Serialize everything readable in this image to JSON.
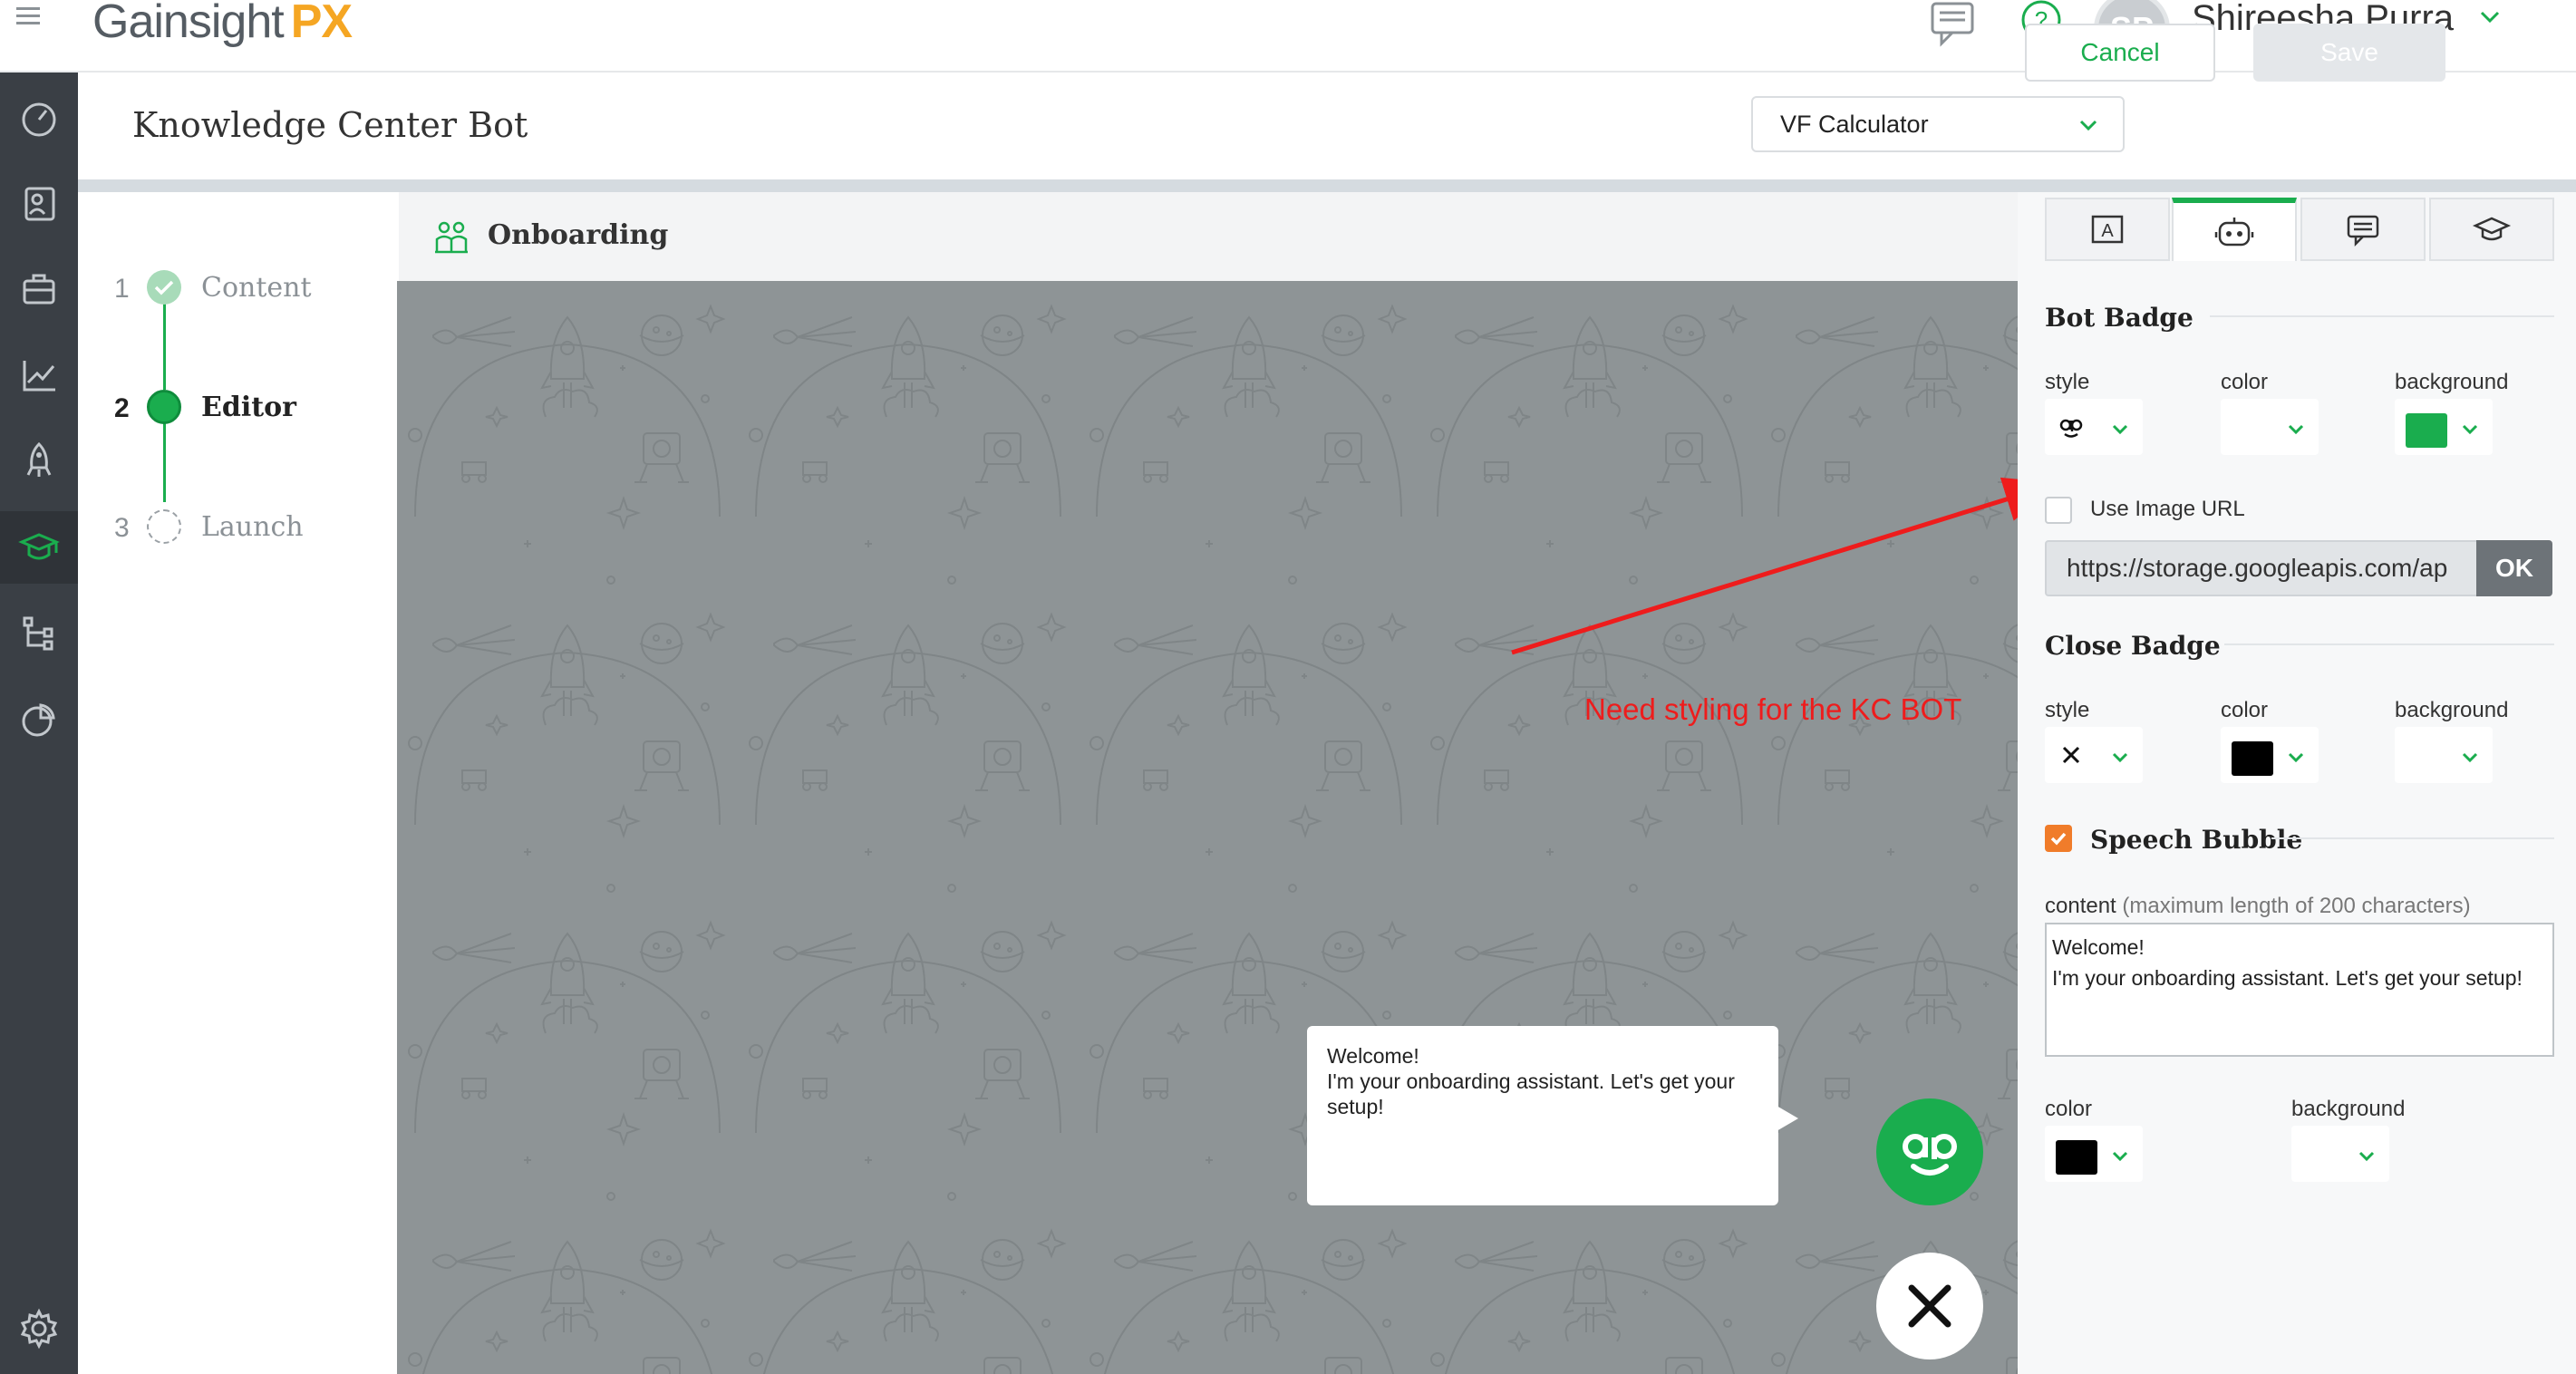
{
  "app": {
    "logo_main": "Gainsight",
    "logo_accent": "PX"
  },
  "user": {
    "initials": "SP",
    "name": "Shireesha Purra"
  },
  "header": {
    "title": "Knowledge Center Bot",
    "selected_guide": "VF Calculator",
    "cancel_label": "Cancel",
    "save_label": "Save"
  },
  "steps": [
    {
      "number": "1",
      "label": "Content",
      "state": "done"
    },
    {
      "number": "2",
      "label": "Editor",
      "state": "current"
    },
    {
      "number": "3",
      "label": "Launch",
      "state": "pending"
    }
  ],
  "canvas": {
    "section": "Onboarding",
    "annotation": "Need styling for the KC BOT",
    "bubble_lines": [
      "Welcome!",
      "I'm your onboarding assistant. Let's get your",
      "setup!"
    ]
  },
  "panel": {
    "bot_badge": {
      "title": "Bot Badge",
      "style_label": "style",
      "color_label": "color",
      "background_label": "background",
      "background_color": "#1aad4e",
      "use_image_label": "Use Image URL",
      "use_image_checked": false,
      "image_url": "https://storage.googleapis.com/ap",
      "ok_label": "OK"
    },
    "close_badge": {
      "title": "Close Badge",
      "style_label": "style",
      "color_label": "color",
      "background_label": "background",
      "color_value": "#000000"
    },
    "speech_bubble": {
      "title": "Speech Bubble",
      "checked": true,
      "content_label": "content",
      "content_hint": "(maximum length of 200 characters)",
      "content_lines": [
        "Welcome!",
        "I'm your onboarding assistant. Let's get your setup!"
      ],
      "color_label": "color",
      "background_label": "background",
      "color_value": "#000000"
    }
  },
  "colors": {
    "brand_green": "#1aad4e",
    "accent_orange": "#f07c2a",
    "annotation_red": "#ee1c1c"
  }
}
